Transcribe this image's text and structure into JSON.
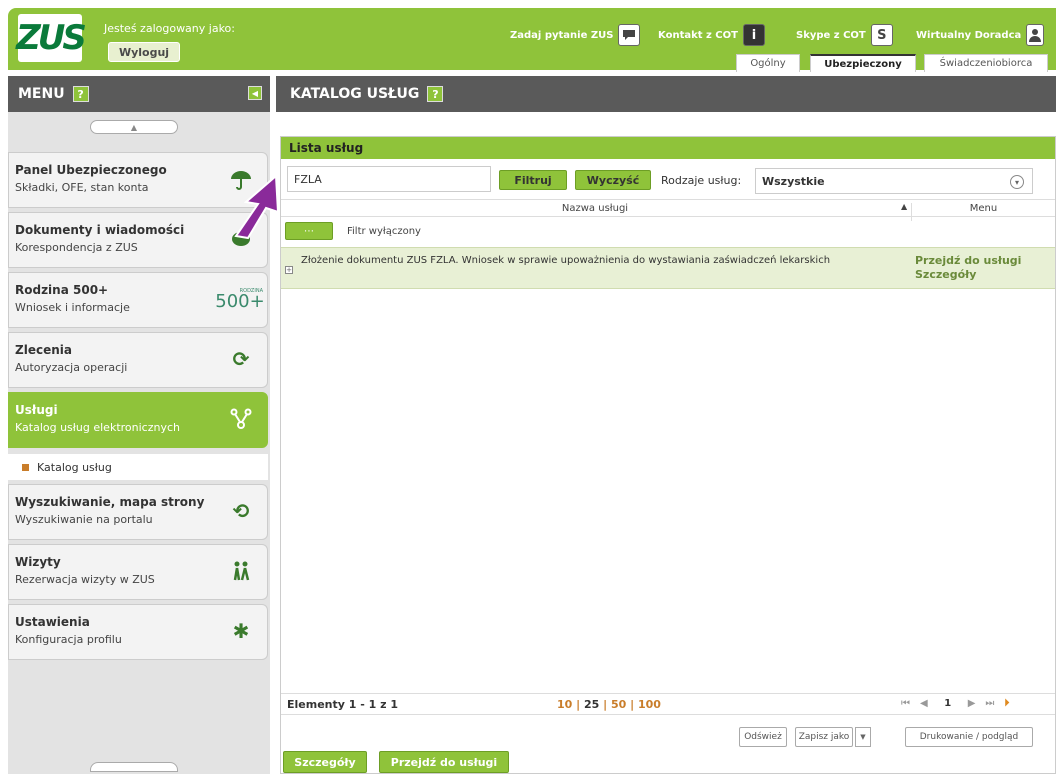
{
  "header": {
    "logo_text": "ZUS",
    "logged_in_label": "Jesteś zalogowany jako:",
    "logout_label": "Wyloguj",
    "links": [
      {
        "label": "Zadaj pytanie ZUS",
        "icon": "chat-icon"
      },
      {
        "label": "Kontakt z COT",
        "icon": "info-icon"
      },
      {
        "label": "Skype z COT",
        "icon": "skype-icon"
      },
      {
        "label": "Wirtualny Doradca",
        "icon": "user-icon"
      }
    ],
    "tabs": [
      {
        "label": "Ogólny",
        "active": false
      },
      {
        "label": "Ubezpieczony",
        "active": true
      },
      {
        "label": "Świadczeniobiorca",
        "active": false
      }
    ],
    "color": "#8fc33a"
  },
  "sidebar": {
    "title": "MENU",
    "help": "?",
    "items": [
      {
        "title": "Panel Ubezpieczonego",
        "subtitle": "Składki, OFE, stan konta",
        "icon": "umbrella-icon"
      },
      {
        "title": "Dokumenty i wiadomości",
        "subtitle": "Korespondencja z ZUS",
        "icon": "leaf-icon"
      },
      {
        "title": "Rodzina 500+",
        "subtitle": "Wniosek i informacje",
        "icon": "500plus-icon",
        "icon_text": "500+",
        "icon_small": "RODZINA"
      },
      {
        "title": "Zlecenia",
        "subtitle": "Autoryzacja operacji",
        "icon": "refresh-icon"
      },
      {
        "title": "Usługi",
        "subtitle": "Katalog usług elektronicznych",
        "icon": "connect-icon"
      },
      {
        "title": "Wyszukiwanie, mapa strony",
        "subtitle": "Wyszukiwanie na portalu",
        "icon": "search-sync-icon"
      },
      {
        "title": "Wizyty",
        "subtitle": "Rezerwacja wizyty w ZUS",
        "icon": "people-icon"
      },
      {
        "title": "Ustawienia",
        "subtitle": "Konfiguracja profilu",
        "icon": "puzzle-icon"
      }
    ],
    "sub_item": "Katalog usług"
  },
  "main": {
    "title": "KATALOG USŁUG",
    "help": "?",
    "panel_title": "Lista usług",
    "search_value": "FZLA",
    "filter_button": "Filtruj",
    "clear_button": "Wyczyść",
    "types_label": "Rodzaje usług:",
    "types_value": "Wszystkie",
    "columns": {
      "name": "Nazwa usługi",
      "menu": "Menu"
    },
    "filter_state": "Filtr wyłączony",
    "rows": [
      {
        "name": "Złożenie dokumentu ZUS FZLA. Wniosek w sprawie upoważnienia do wystawiania zaświadczeń lekarskich",
        "go": "Przejdź do usługi",
        "details": "Szczegóły"
      }
    ],
    "pager": {
      "count": "Elementy 1 - 1 z 1",
      "sizes": [
        "10",
        "25",
        "50",
        "100"
      ],
      "selected_size": "25",
      "page": "1"
    },
    "actions": {
      "refresh": "Odśwież",
      "save_as": "Zapisz jako",
      "print": "Drukowanie / podgląd",
      "details": "Szczegóły",
      "go": "Przejdź do usługi"
    }
  }
}
